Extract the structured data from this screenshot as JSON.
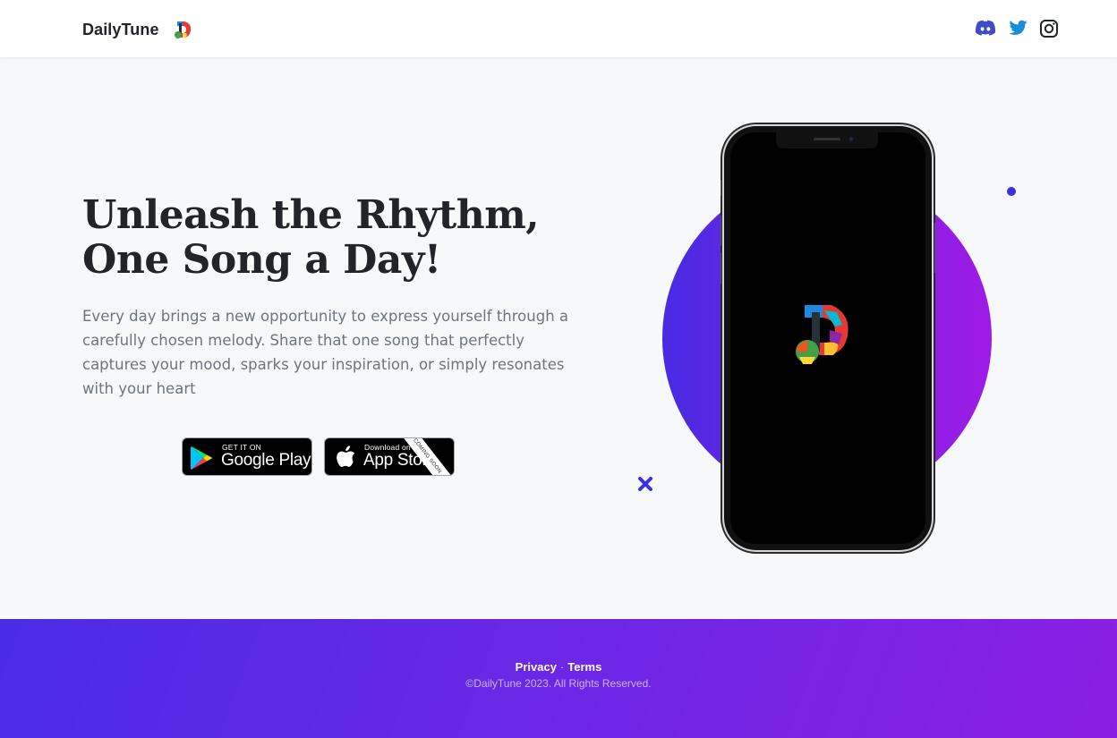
{
  "nav": {
    "brand": "DailyTune",
    "socials": [
      {
        "name": "discord-icon",
        "label": "Discord"
      },
      {
        "name": "twitter-icon",
        "label": "Twitter"
      },
      {
        "name": "instagram-icon",
        "label": "Instagram"
      }
    ]
  },
  "hero": {
    "headline_line1": "Unleash the Rhythm,",
    "headline_line2": "One Song a Day!",
    "lead": "Every day brings a new opportunity to express yourself through a carefully chosen melody. Share that one song that perfectly captures your mood, sparks your inspiration, or simply resonates with your heart"
  },
  "stores": {
    "google": {
      "small": "GET IT ON",
      "big": "Google Play",
      "icon": "google-play-icon"
    },
    "apple": {
      "small": "Download on the",
      "big": "App Store",
      "ribbon": "COMING SOON",
      "icon": "apple-icon"
    }
  },
  "footer": {
    "privacy": "Privacy",
    "separator": "·",
    "terms": "Terms",
    "copyright": "©DailyTune 2023. All Rights Reserved."
  },
  "colors": {
    "accent_start": "#4a2ae3",
    "accent_end": "#9e1be6",
    "discord": "#5865f2",
    "twitter": "#1d9bf0"
  }
}
